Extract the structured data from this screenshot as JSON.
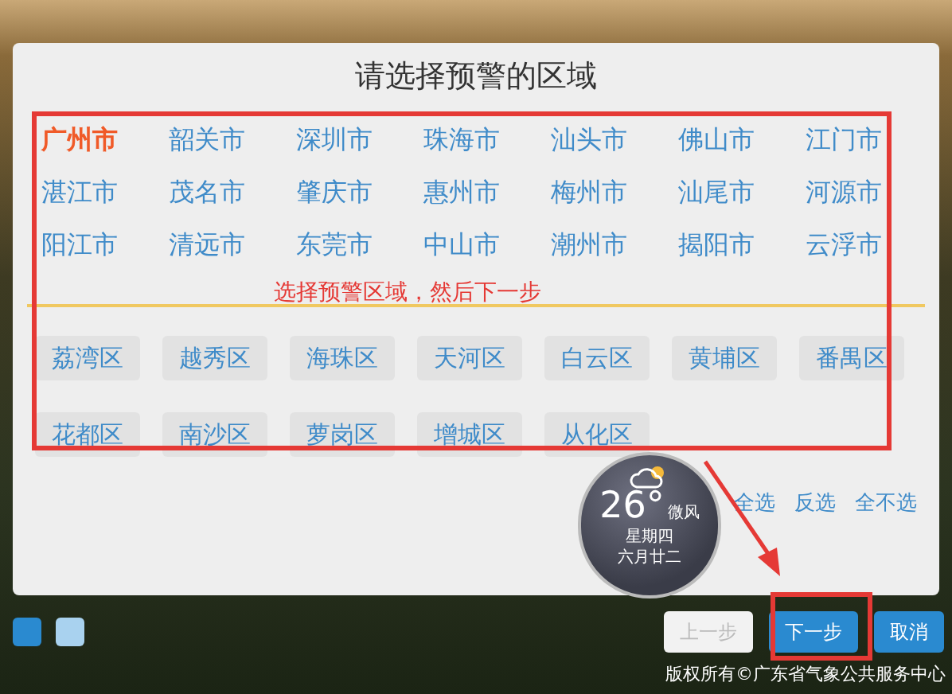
{
  "dialog": {
    "title": "请选择预警的区域"
  },
  "cities": [
    {
      "label": "广州市",
      "selected": true
    },
    {
      "label": "韶关市",
      "selected": false
    },
    {
      "label": "深圳市",
      "selected": false
    },
    {
      "label": "珠海市",
      "selected": false
    },
    {
      "label": "汕头市",
      "selected": false
    },
    {
      "label": "佛山市",
      "selected": false
    },
    {
      "label": "江门市",
      "selected": false
    },
    {
      "label": "湛江市",
      "selected": false
    },
    {
      "label": "茂名市",
      "selected": false
    },
    {
      "label": "肇庆市",
      "selected": false
    },
    {
      "label": "惠州市",
      "selected": false
    },
    {
      "label": "梅州市",
      "selected": false
    },
    {
      "label": "汕尾市",
      "selected": false
    },
    {
      "label": "河源市",
      "selected": false
    },
    {
      "label": "阳江市",
      "selected": false
    },
    {
      "label": "清远市",
      "selected": false
    },
    {
      "label": "东莞市",
      "selected": false
    },
    {
      "label": "中山市",
      "selected": false
    },
    {
      "label": "潮州市",
      "selected": false
    },
    {
      "label": "揭阳市",
      "selected": false
    },
    {
      "label": "云浮市",
      "selected": false
    }
  ],
  "annotation": "选择预警区域，然后下一步",
  "districts": [
    {
      "label": "荔湾区",
      "selected": false
    },
    {
      "label": "越秀区",
      "selected": false
    },
    {
      "label": "海珠区",
      "selected": false
    },
    {
      "label": "天河区",
      "selected": false
    },
    {
      "label": "白云区",
      "selected": false
    },
    {
      "label": "黄埔区",
      "selected": false
    },
    {
      "label": "番禺区",
      "selected": false
    },
    {
      "label": "花都区",
      "selected": false
    },
    {
      "label": "南沙区",
      "selected": false
    },
    {
      "label": "萝岗区",
      "selected": false
    },
    {
      "label": "增城区",
      "selected": false
    },
    {
      "label": "从化区",
      "selected": false
    }
  ],
  "selection_links": [
    "全选",
    "反选",
    "全不选"
  ],
  "weather": {
    "temperature": "26°",
    "wind": "微风",
    "weekday": "星期四",
    "lunar_date": "六月廿二"
  },
  "pager_dots": [
    {
      "selected": true
    },
    {
      "selected": false
    }
  ],
  "buttons": [
    {
      "label": "上一步",
      "disabled": true
    },
    {
      "label": "下一步",
      "disabled": false
    },
    {
      "label": "取消",
      "disabled": false
    }
  ],
  "footer": "版权所有©广东省气象公共服务中心"
}
